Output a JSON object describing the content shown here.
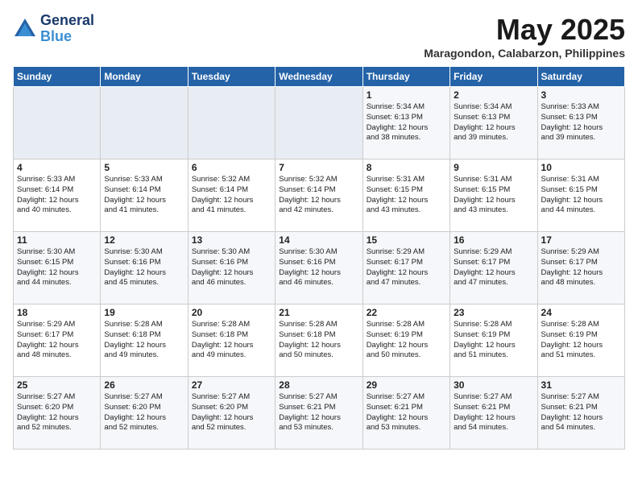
{
  "header": {
    "logo_line1": "General",
    "logo_line2": "Blue",
    "month": "May 2025",
    "location": "Maragondon, Calabarzon, Philippines"
  },
  "weekdays": [
    "Sunday",
    "Monday",
    "Tuesday",
    "Wednesday",
    "Thursday",
    "Friday",
    "Saturday"
  ],
  "weeks": [
    [
      {
        "day": "",
        "text": ""
      },
      {
        "day": "",
        "text": ""
      },
      {
        "day": "",
        "text": ""
      },
      {
        "day": "",
        "text": ""
      },
      {
        "day": "1",
        "text": "Sunrise: 5:34 AM\nSunset: 6:13 PM\nDaylight: 12 hours\nand 38 minutes."
      },
      {
        "day": "2",
        "text": "Sunrise: 5:34 AM\nSunset: 6:13 PM\nDaylight: 12 hours\nand 39 minutes."
      },
      {
        "day": "3",
        "text": "Sunrise: 5:33 AM\nSunset: 6:13 PM\nDaylight: 12 hours\nand 39 minutes."
      }
    ],
    [
      {
        "day": "4",
        "text": "Sunrise: 5:33 AM\nSunset: 6:14 PM\nDaylight: 12 hours\nand 40 minutes."
      },
      {
        "day": "5",
        "text": "Sunrise: 5:33 AM\nSunset: 6:14 PM\nDaylight: 12 hours\nand 41 minutes."
      },
      {
        "day": "6",
        "text": "Sunrise: 5:32 AM\nSunset: 6:14 PM\nDaylight: 12 hours\nand 41 minutes."
      },
      {
        "day": "7",
        "text": "Sunrise: 5:32 AM\nSunset: 6:14 PM\nDaylight: 12 hours\nand 42 minutes."
      },
      {
        "day": "8",
        "text": "Sunrise: 5:31 AM\nSunset: 6:15 PM\nDaylight: 12 hours\nand 43 minutes."
      },
      {
        "day": "9",
        "text": "Sunrise: 5:31 AM\nSunset: 6:15 PM\nDaylight: 12 hours\nand 43 minutes."
      },
      {
        "day": "10",
        "text": "Sunrise: 5:31 AM\nSunset: 6:15 PM\nDaylight: 12 hours\nand 44 minutes."
      }
    ],
    [
      {
        "day": "11",
        "text": "Sunrise: 5:30 AM\nSunset: 6:15 PM\nDaylight: 12 hours\nand 44 minutes."
      },
      {
        "day": "12",
        "text": "Sunrise: 5:30 AM\nSunset: 6:16 PM\nDaylight: 12 hours\nand 45 minutes."
      },
      {
        "day": "13",
        "text": "Sunrise: 5:30 AM\nSunset: 6:16 PM\nDaylight: 12 hours\nand 46 minutes."
      },
      {
        "day": "14",
        "text": "Sunrise: 5:30 AM\nSunset: 6:16 PM\nDaylight: 12 hours\nand 46 minutes."
      },
      {
        "day": "15",
        "text": "Sunrise: 5:29 AM\nSunset: 6:17 PM\nDaylight: 12 hours\nand 47 minutes."
      },
      {
        "day": "16",
        "text": "Sunrise: 5:29 AM\nSunset: 6:17 PM\nDaylight: 12 hours\nand 47 minutes."
      },
      {
        "day": "17",
        "text": "Sunrise: 5:29 AM\nSunset: 6:17 PM\nDaylight: 12 hours\nand 48 minutes."
      }
    ],
    [
      {
        "day": "18",
        "text": "Sunrise: 5:29 AM\nSunset: 6:17 PM\nDaylight: 12 hours\nand 48 minutes."
      },
      {
        "day": "19",
        "text": "Sunrise: 5:28 AM\nSunset: 6:18 PM\nDaylight: 12 hours\nand 49 minutes."
      },
      {
        "day": "20",
        "text": "Sunrise: 5:28 AM\nSunset: 6:18 PM\nDaylight: 12 hours\nand 49 minutes."
      },
      {
        "day": "21",
        "text": "Sunrise: 5:28 AM\nSunset: 6:18 PM\nDaylight: 12 hours\nand 50 minutes."
      },
      {
        "day": "22",
        "text": "Sunrise: 5:28 AM\nSunset: 6:19 PM\nDaylight: 12 hours\nand 50 minutes."
      },
      {
        "day": "23",
        "text": "Sunrise: 5:28 AM\nSunset: 6:19 PM\nDaylight: 12 hours\nand 51 minutes."
      },
      {
        "day": "24",
        "text": "Sunrise: 5:28 AM\nSunset: 6:19 PM\nDaylight: 12 hours\nand 51 minutes."
      }
    ],
    [
      {
        "day": "25",
        "text": "Sunrise: 5:27 AM\nSunset: 6:20 PM\nDaylight: 12 hours\nand 52 minutes."
      },
      {
        "day": "26",
        "text": "Sunrise: 5:27 AM\nSunset: 6:20 PM\nDaylight: 12 hours\nand 52 minutes."
      },
      {
        "day": "27",
        "text": "Sunrise: 5:27 AM\nSunset: 6:20 PM\nDaylight: 12 hours\nand 52 minutes."
      },
      {
        "day": "28",
        "text": "Sunrise: 5:27 AM\nSunset: 6:21 PM\nDaylight: 12 hours\nand 53 minutes."
      },
      {
        "day": "29",
        "text": "Sunrise: 5:27 AM\nSunset: 6:21 PM\nDaylight: 12 hours\nand 53 minutes."
      },
      {
        "day": "30",
        "text": "Sunrise: 5:27 AM\nSunset: 6:21 PM\nDaylight: 12 hours\nand 54 minutes."
      },
      {
        "day": "31",
        "text": "Sunrise: 5:27 AM\nSunset: 6:21 PM\nDaylight: 12 hours\nand 54 minutes."
      }
    ]
  ]
}
